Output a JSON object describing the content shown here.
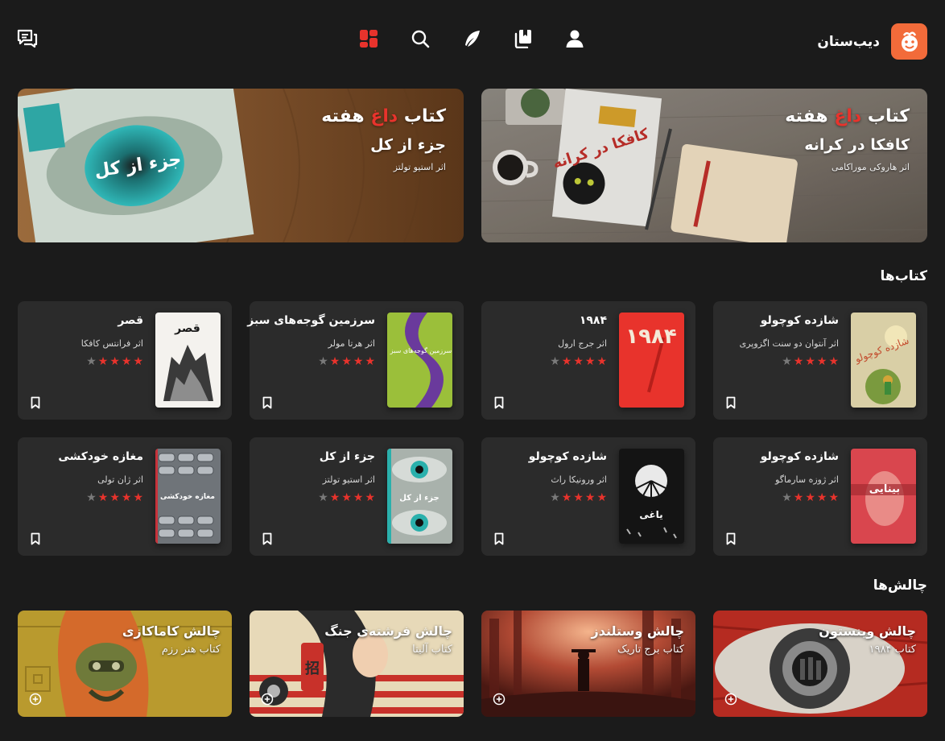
{
  "brand": {
    "name": "دیب‌ستان",
    "accent": "#f26b3a"
  },
  "nav": [
    {
      "icon": "dashboard-icon",
      "active": true
    },
    {
      "icon": "search-icon",
      "active": false
    },
    {
      "icon": "feather-icon",
      "active": false
    },
    {
      "icon": "library-icon",
      "active": false
    },
    {
      "icon": "user-icon",
      "active": false
    }
  ],
  "hero": [
    {
      "kicker_before": "کتاب ",
      "kicker_accent": "داغ",
      "kicker_after": " هفته",
      "title": "کافکا در کرانه",
      "author": "اثر هاروکی موراکامی",
      "cover_text": "کافکا در کرانه"
    },
    {
      "kicker_before": "کتاب ",
      "kicker_accent": "داغ",
      "kicker_after": " هفته",
      "title": "جزء از کل",
      "author": "اثر استیو تولتز",
      "cover_text": "جزء از کل"
    }
  ],
  "sections": {
    "books": "کتاب‌ها",
    "challenges": "چالش‌ها"
  },
  "books": [
    {
      "title": "شازده کوچولو",
      "author": "اثر آنتوان دو سنت اگزوپری",
      "rating": 4,
      "cover_text": "شازده کوچولو"
    },
    {
      "title": "۱۹۸۴",
      "author": "اثر جرج ارول",
      "rating": 4,
      "cover_text": "۱۹۸۴"
    },
    {
      "title": "سرزمین گوجه‌های سبز",
      "author": "اثر هرتا مولر",
      "rating": 4,
      "cover_text": "سرزمین گوجه‌های سبز"
    },
    {
      "title": "قصر",
      "author": "اثر فرانتس کافکا",
      "rating": 4,
      "cover_text": "قصر"
    },
    {
      "title": "شازده کوچولو",
      "author": "اثر ژوزه سارماگو",
      "rating": 4,
      "cover_text": "بینایی"
    },
    {
      "title": "شازده کوچولو",
      "author": "اثر ورونیکا راث",
      "rating": 4,
      "cover_text": "یاغی"
    },
    {
      "title": "جزء از کل",
      "author": "اثر استیو تولتز",
      "rating": 4,
      "cover_text": "جزء از کل"
    },
    {
      "title": "مغازه خودکشی",
      "author": "اثر ژان تولی",
      "rating": 4,
      "cover_text": "مغازه خودکشی"
    }
  ],
  "challenges": [
    {
      "title": "چالش وینستون",
      "subtitle": "کتاب ۱۹۸۴"
    },
    {
      "title": "چالش وستلندز",
      "subtitle": "کتاب برج تاریک"
    },
    {
      "title": "چالش فرشته‌ی جنگ",
      "subtitle": "کتاب آلیتا"
    },
    {
      "title": "چالش کاماکازی",
      "subtitle": "کتاب هنر رزم"
    }
  ],
  "colors": {
    "accent": "#e8332c",
    "card": "#2b2b2b",
    "background": "#1b1b1b"
  }
}
